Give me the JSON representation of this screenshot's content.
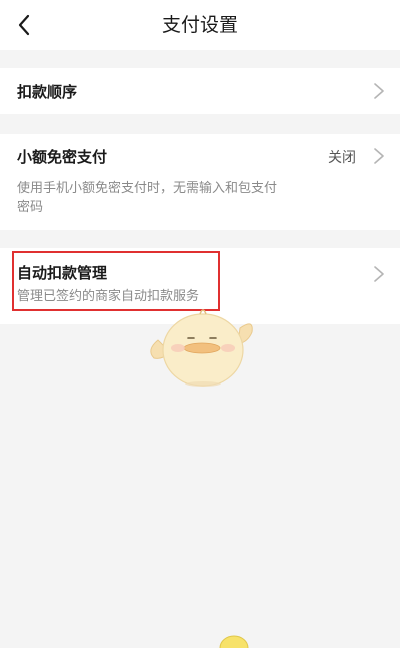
{
  "header": {
    "title": "支付设置",
    "back_icon": "chevron-left-icon"
  },
  "rows": {
    "deduction_order": {
      "label": "扣款顺序",
      "icon": "chevron-right-icon"
    },
    "small_amount_free_pay": {
      "label": "小额免密支付",
      "status": "关闭",
      "description": "使用手机小额免密支付时，无需输入和包支付密码",
      "icon": "chevron-right-icon"
    },
    "auto_deduction": {
      "label": "自动扣款管理",
      "description": "管理已签约的商家自动扣款服务",
      "icon": "chevron-right-icon"
    }
  },
  "colors": {
    "background": "#f4f4f4",
    "card": "#ffffff",
    "highlight_border": "#e03030"
  }
}
